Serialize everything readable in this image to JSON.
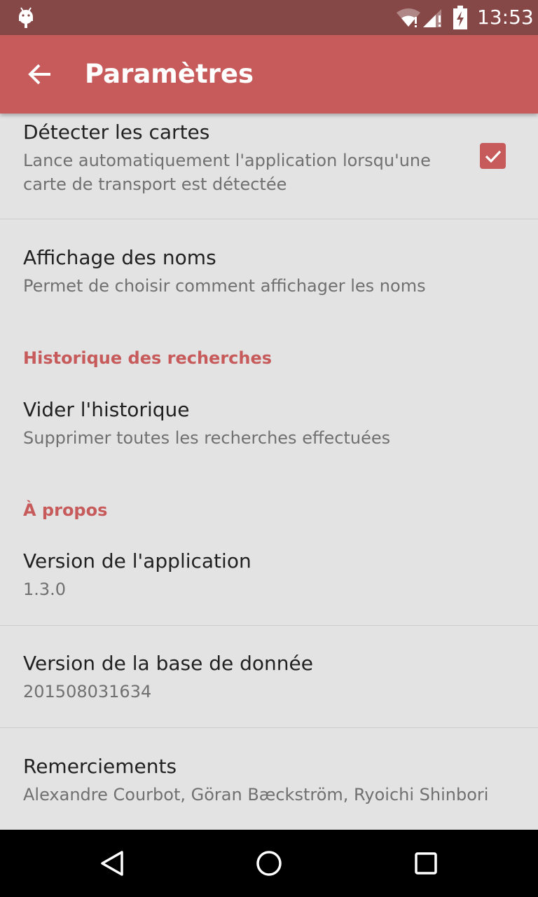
{
  "status_bar": {
    "time": "13:53",
    "icons": [
      "android-icon",
      "wifi-icon",
      "signal-icon",
      "battery-charging-icon"
    ]
  },
  "app_bar": {
    "title": "Paramètres",
    "back_icon": "arrow-back-icon"
  },
  "preferences": {
    "detect_cards": {
      "title": "Détecter les cartes",
      "summary": "Lance automatiquement l'application lorsqu'une carte de transport est détectée",
      "checked": true
    },
    "name_display": {
      "title": "Affichage des noms",
      "summary": "Permet de choisir comment affichager les noms"
    },
    "history_category": "Historique des recherches",
    "clear_history": {
      "title": "Vider l'historique",
      "summary": "Supprimer toutes les recherches effectuées"
    },
    "about_category": "À propos",
    "app_version": {
      "title": "Version de l'application",
      "summary": "1.3.0"
    },
    "db_version": {
      "title": "Version de la base de donnée",
      "summary": "201508031634"
    },
    "thanks": {
      "title": "Remerciements",
      "summary": "Alexandre Courbot, Göran Bæckström, Ryoichi Shinbori"
    }
  },
  "nav_bar": {
    "icons": [
      "back-triangle-icon",
      "home-circle-icon",
      "recents-square-icon"
    ]
  },
  "colors": {
    "status_bar": "#864747",
    "app_bar": "#c75b5b",
    "accent": "#c75b5b",
    "background": "#e3e3e3"
  }
}
